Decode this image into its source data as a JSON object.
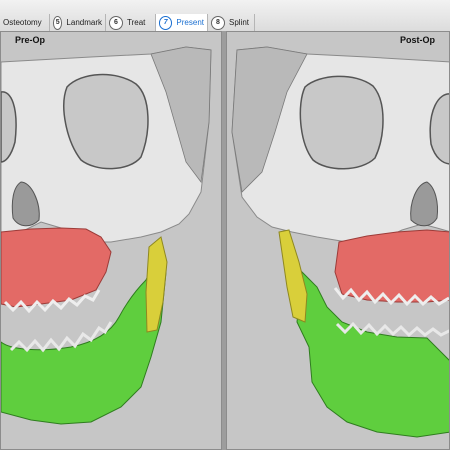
{
  "tabs": [
    {
      "num": "",
      "label": "Osteotomy"
    },
    {
      "num": "5",
      "label": "Landmark"
    },
    {
      "num": "6",
      "label": "Treat"
    },
    {
      "num": "7",
      "label": "Present"
    },
    {
      "num": "8",
      "label": "Splint"
    }
  ],
  "active_tab": "Present",
  "panels": {
    "left": {
      "title": "Pre-Op"
    },
    "right": {
      "title": "Post-Op"
    }
  },
  "colors": {
    "bone": "#e6e6e6",
    "maxilla": "#e36a66",
    "mandible": "#5fce3e",
    "ramus_segment": "#d9cf3a",
    "viewport": "#c6c6c6",
    "active_tab": "#1a6fd1"
  }
}
